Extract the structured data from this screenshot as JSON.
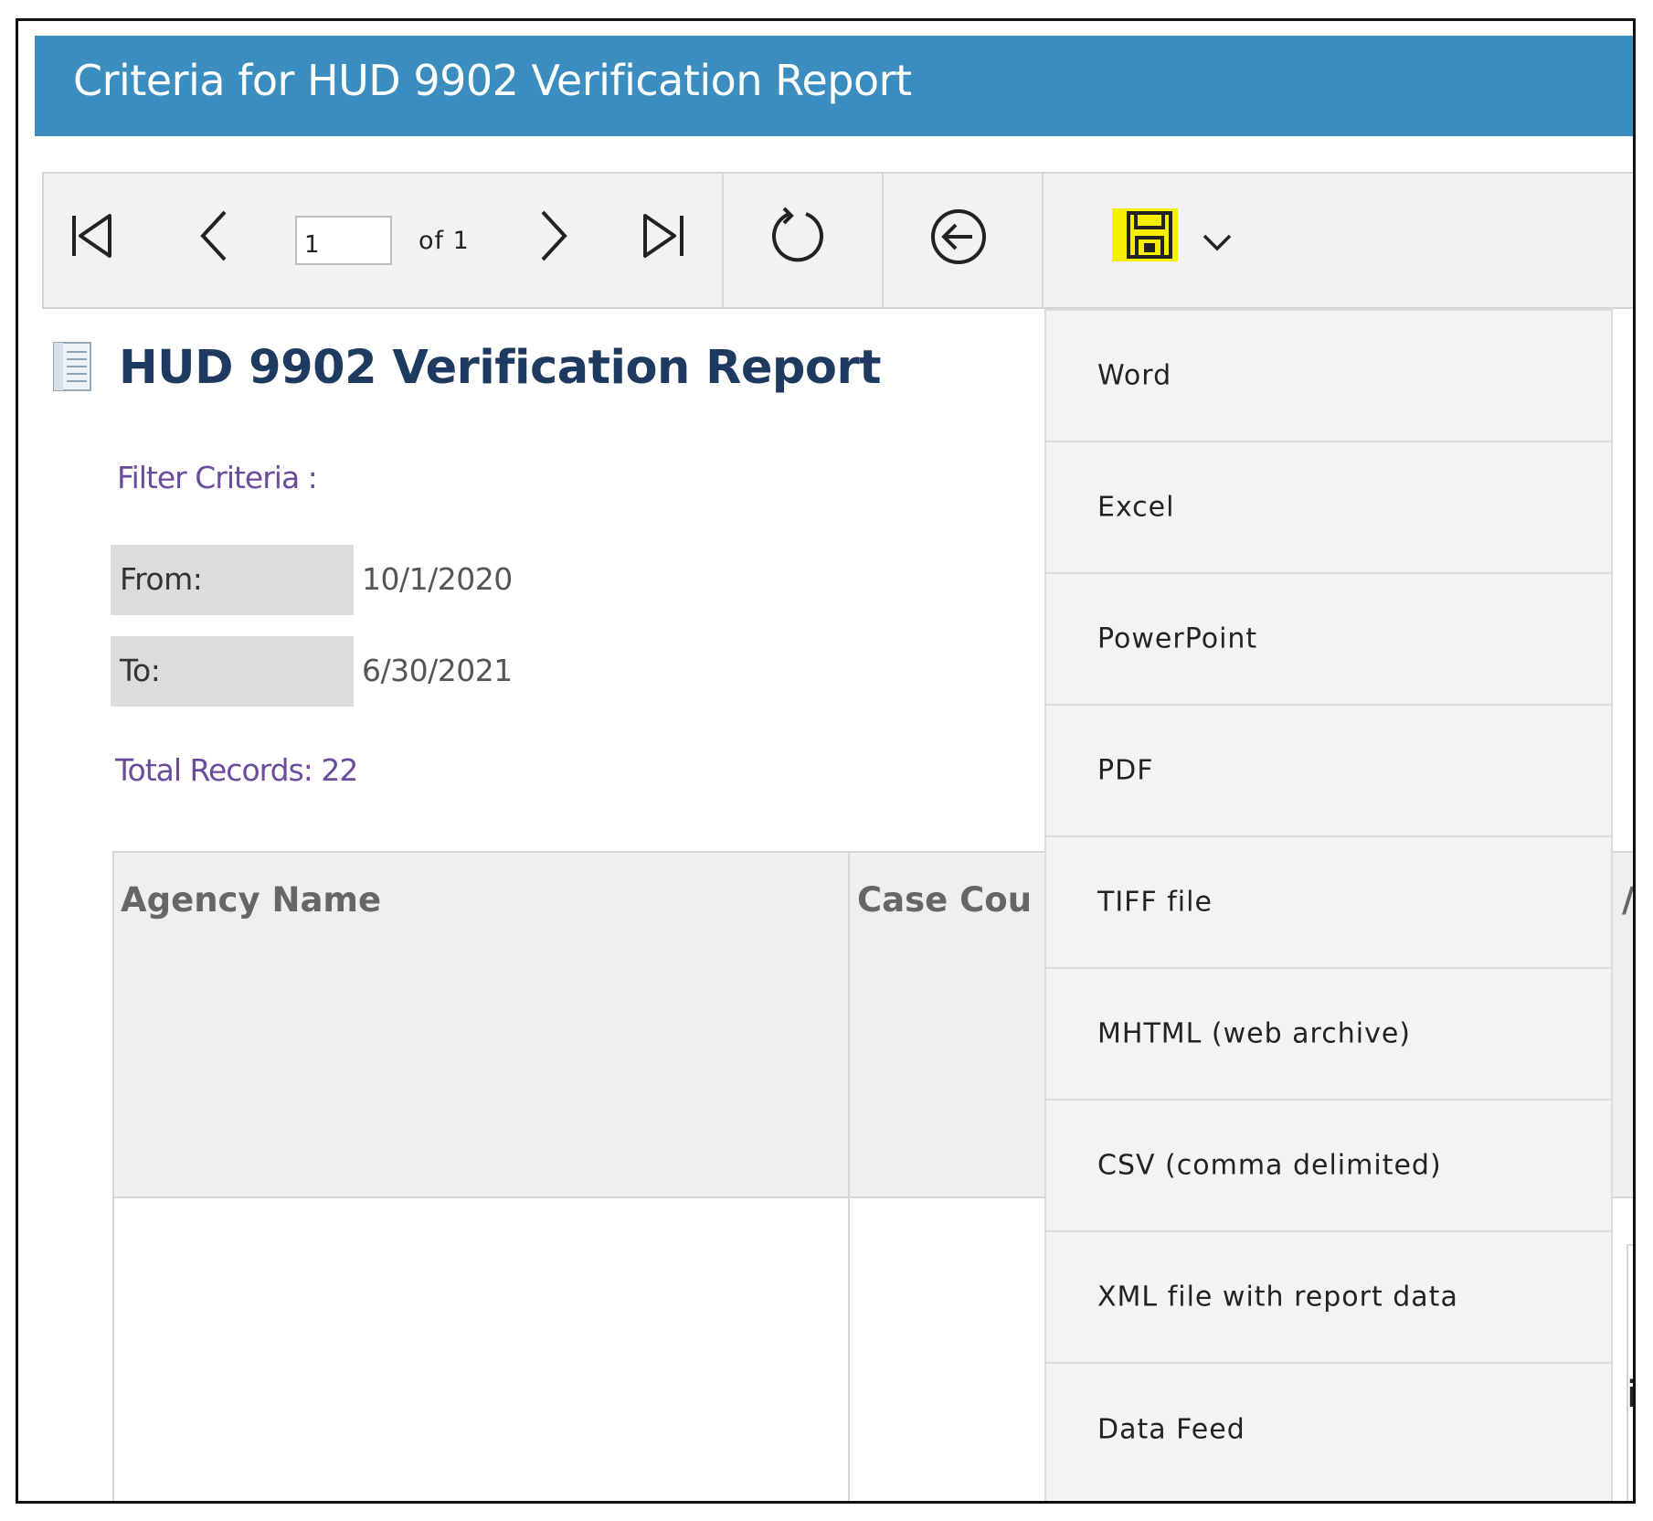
{
  "header": {
    "title": "Criteria for HUD 9902 Verification Report"
  },
  "toolbar": {
    "page_current": "1",
    "page_of": "of 1",
    "icons": [
      "first-page-icon",
      "previous-page-icon",
      "next-page-icon",
      "last-page-icon",
      "refresh-icon",
      "back-icon",
      "save-icon",
      "chevron-down-icon"
    ],
    "highlight_color": "#f4f000"
  },
  "report": {
    "title": "HUD 9902 Verification Report",
    "filter_label": "Filter Criteria :",
    "criteria": [
      {
        "label": "From:",
        "value": "10/1/2020"
      },
      {
        "label": "To:",
        "value": "6/30/2021"
      }
    ],
    "total_records": "Total Records: 22",
    "columns": [
      "Agency Name",
      "Case Cou"
    ],
    "peek_header_fragment": "/p",
    "peek_cell_fragment": "ic"
  },
  "export_menu": {
    "items": [
      "Word",
      "Excel",
      "PowerPoint",
      "PDF",
      "TIFF file",
      "MHTML (web archive)",
      "CSV (comma delimited)",
      "XML file with report data",
      "Data Feed"
    ]
  },
  "colors": {
    "header_bg": "#3b8dbf",
    "title_text": "#1f3a60",
    "label_purple": "#6b4b9b"
  }
}
